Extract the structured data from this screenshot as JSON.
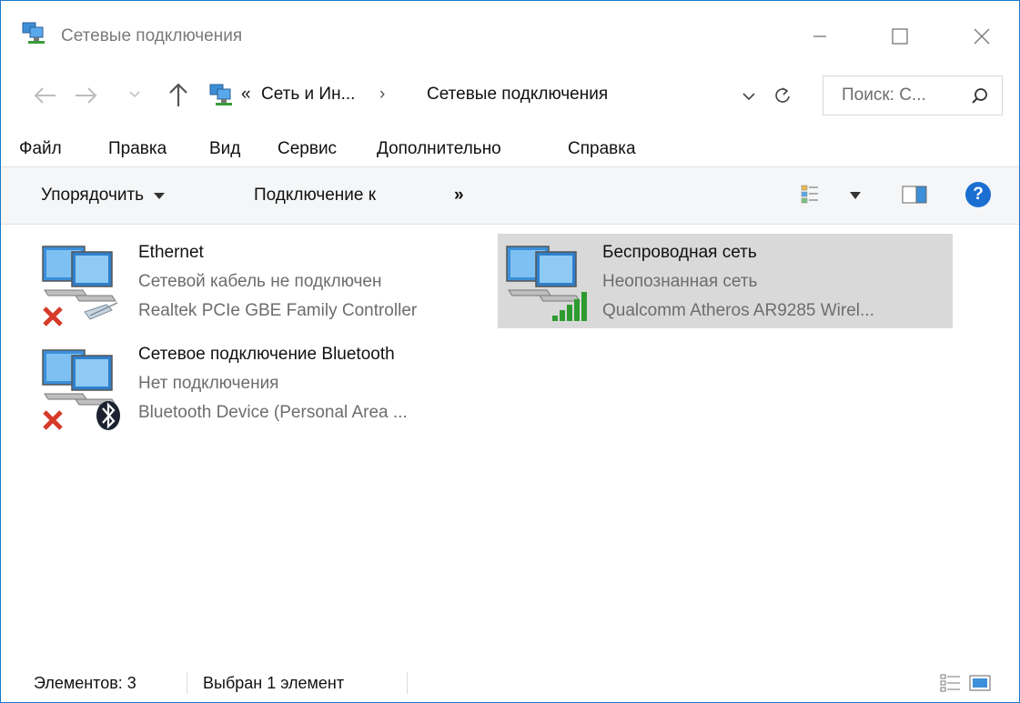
{
  "window": {
    "title": "Сетевые подключения",
    "title_icon": "network-connections-icon"
  },
  "address": {
    "prefix": "«",
    "segment1": "Сеть и Ин...",
    "separator": "›",
    "segment2": "Сетевые подключения",
    "search_placeholder": "Поиск: С..."
  },
  "menu": {
    "items": [
      "Файл",
      "Правка",
      "Вид",
      "Сервис",
      "Дополнительно",
      "Справка"
    ]
  },
  "commands": {
    "organize": "Упорядочить",
    "connect_to": "Подключение к",
    "more": "»",
    "help": "?"
  },
  "connections": [
    {
      "name": "Ethernet",
      "status": "Сетевой кабель не подключен",
      "device": "Realtek PCIe GBE Family Controller",
      "icon": "ethernet-adapter-icon",
      "selected": false
    },
    {
      "name": "Беспроводная сеть",
      "status": "Неопознанная сеть",
      "device": "Qualcomm Atheros AR9285 Wirel...",
      "icon": "wireless-adapter-icon",
      "selected": true
    },
    {
      "name": "Сетевое подключение Bluetooth",
      "status": "Нет подключения",
      "device": "Bluetooth Device (Personal Area ...",
      "icon": "bluetooth-adapter-icon",
      "selected": false
    }
  ],
  "status": {
    "count": "Элементов: 3",
    "selection": "Выбран 1 элемент"
  },
  "colors": {
    "accent": "#1979ca",
    "selected_bg": "#d9d9d9",
    "error_red": "#d63a2a",
    "signal_green": "#2e9b2e",
    "help_blue": "#1a6fd1"
  }
}
